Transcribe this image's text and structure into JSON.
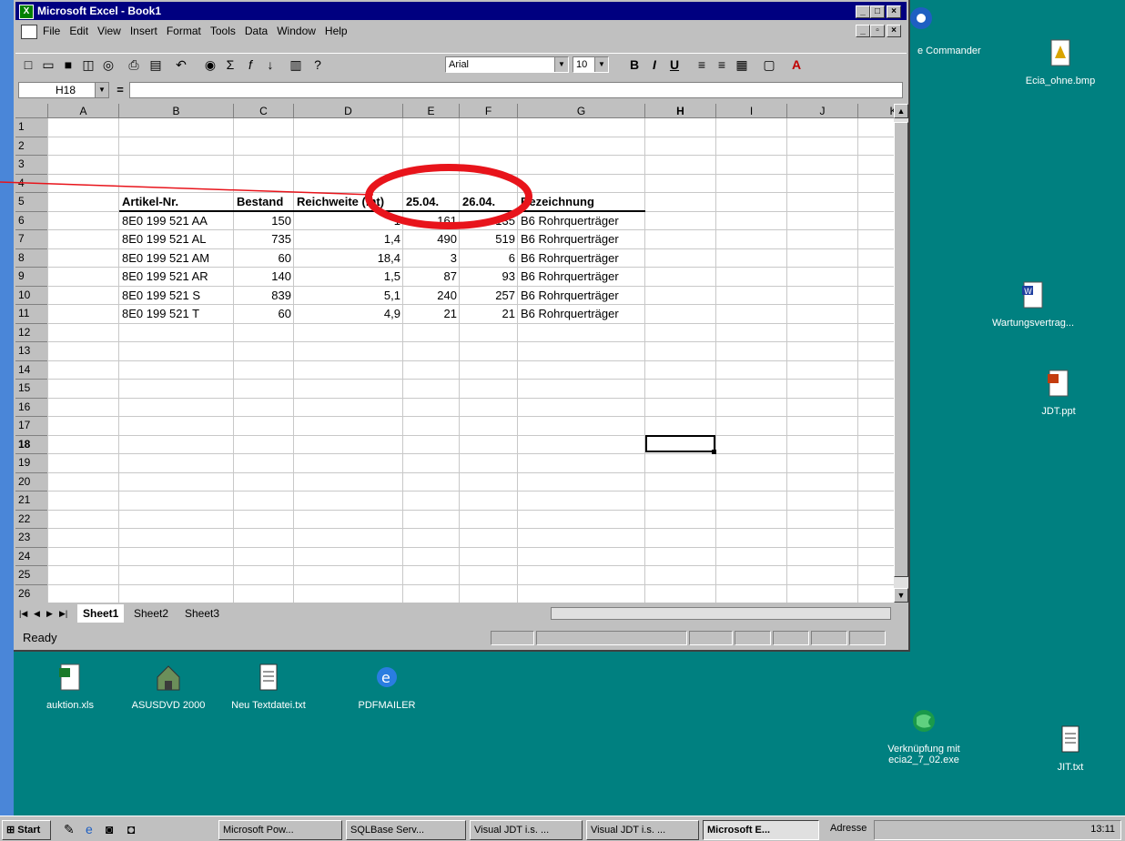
{
  "excel": {
    "title": "Microsoft Excel - Book1",
    "menu": [
      "File",
      "Edit",
      "View",
      "Insert",
      "Format",
      "Tools",
      "Data",
      "Window",
      "Help"
    ],
    "font_name": "Arial",
    "font_size": "10",
    "name_box": "H18",
    "formula_equals": "=",
    "columns": [
      "A",
      "B",
      "C",
      "D",
      "E",
      "F",
      "G",
      "H",
      "I",
      "J",
      "K"
    ],
    "rows": [
      "1",
      "2",
      "3",
      "4",
      "5",
      "6",
      "7",
      "8",
      "9",
      "10",
      "11",
      "12",
      "13",
      "14",
      "15",
      "16",
      "17",
      "18",
      "19",
      "20",
      "21",
      "22",
      "23",
      "24",
      "25",
      "26"
    ],
    "selected_cell": "H18",
    "header_row": {
      "b": "Artikel-Nr.",
      "c": "Bestand",
      "d": "Reichweite (int)",
      "e": "25.04.",
      "f": "26.04.",
      "g": "Bezeichnung"
    },
    "data_rows": [
      {
        "b": "8E0 199 521 AA",
        "c": "150",
        "d": "1",
        "e": "161",
        "f": "135",
        "g": "B6 Rohrquerträger"
      },
      {
        "b": "8E0 199 521 AL",
        "c": "735",
        "d": "1,4",
        "e": "490",
        "f": "519",
        "g": "B6 Rohrquerträger"
      },
      {
        "b": "8E0 199 521 AM",
        "c": "60",
        "d": "18,4",
        "e": "3",
        "f": "6",
        "g": "B6 Rohrquerträger"
      },
      {
        "b": "8E0 199 521 AR",
        "c": "140",
        "d": "1,5",
        "e": "87",
        "f": "93",
        "g": "B6 Rohrquerträger"
      },
      {
        "b": "8E0 199 521 S",
        "c": "839",
        "d": "5,1",
        "e": "240",
        "f": "257",
        "g": "B6 Rohrquerträger"
      },
      {
        "b": "8E0 199 521 T",
        "c": "60",
        "d": "4,9",
        "e": "21",
        "f": "21",
        "g": "B6  Rohrquerträger"
      }
    ],
    "sheets": [
      "Sheet1",
      "Sheet2",
      "Sheet3"
    ],
    "status": "Ready"
  },
  "annotation": {
    "color": "#e8141b"
  },
  "desktop_icons": [
    {
      "label": "e Commander"
    },
    {
      "label": "Ecia_ohne.bmp"
    },
    {
      "label": "Wartungsvertrag..."
    },
    {
      "label": "JDT.ppt"
    },
    {
      "label": "auktion.xls"
    },
    {
      "label": "ASUSDVD 2000"
    },
    {
      "label": "Neu Textdatei.txt"
    },
    {
      "label": "PDFMAILER"
    },
    {
      "label": "Verknüpfung mit ecia2_7_02.exe"
    },
    {
      "label": "JIT.txt"
    }
  ],
  "taskbar": {
    "start": "Start",
    "buttons": [
      "Microsoft Pow...",
      "SQLBase Serv...",
      "Visual JDT i.s. ...",
      "Visual JDT i.s. ...",
      "Microsoft E..."
    ],
    "address": "Adresse",
    "clock": "13:11"
  }
}
